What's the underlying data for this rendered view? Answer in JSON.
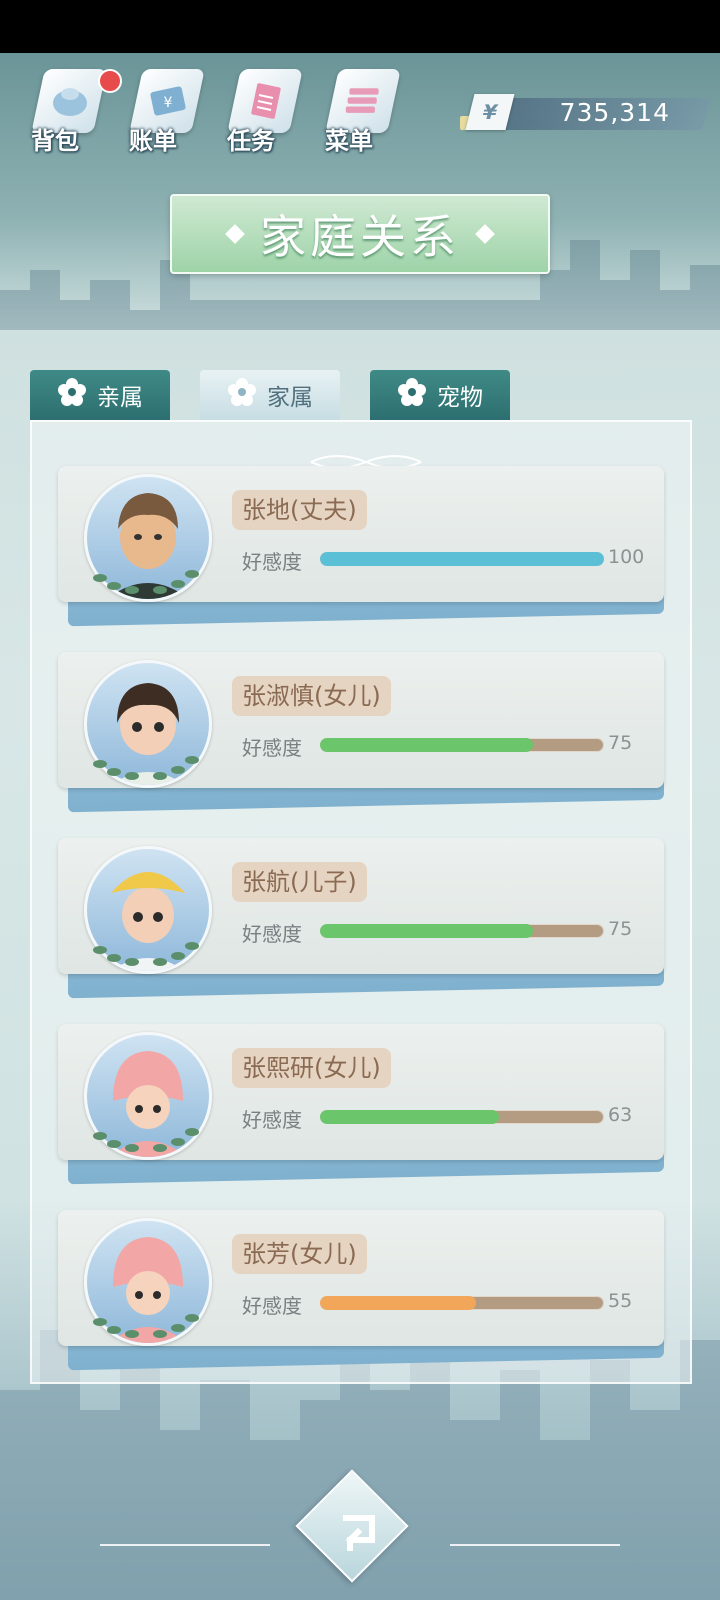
{
  "toolbar": {
    "items": [
      {
        "label": "背包",
        "icon": "bag-icon",
        "has_badge": true
      },
      {
        "label": "账单",
        "icon": "bill-icon"
      },
      {
        "label": "任务",
        "icon": "task-icon"
      },
      {
        "label": "菜单",
        "icon": "menu-icon"
      }
    ]
  },
  "currency": {
    "symbol": "¥",
    "value": "735,314"
  },
  "title": "家庭关系",
  "tabs": [
    {
      "label": "亲属",
      "active": false
    },
    {
      "label": "家属",
      "active": true
    },
    {
      "label": "宠物",
      "active": false
    }
  ],
  "favor_label": "好感度",
  "members": [
    {
      "name": "张地(丈夫)",
      "favor": 100,
      "bar_color": "#5bbfd6"
    },
    {
      "name": "张淑慎(女儿)",
      "favor": 75,
      "bar_color": "#6bc56a"
    },
    {
      "name": "张航(儿子)",
      "favor": 75,
      "bar_color": "#6bc56a"
    },
    {
      "name": "张熙研(女儿)",
      "favor": 63,
      "bar_color": "#6bc56a"
    },
    {
      "name": "张芳(女儿)",
      "favor": 55,
      "bar_color": "#f2a65a"
    }
  ],
  "colors": {
    "accent_green": "#9ed3a8",
    "tab_teal": "#2d6f70",
    "badge_red": "#e84b4b"
  }
}
